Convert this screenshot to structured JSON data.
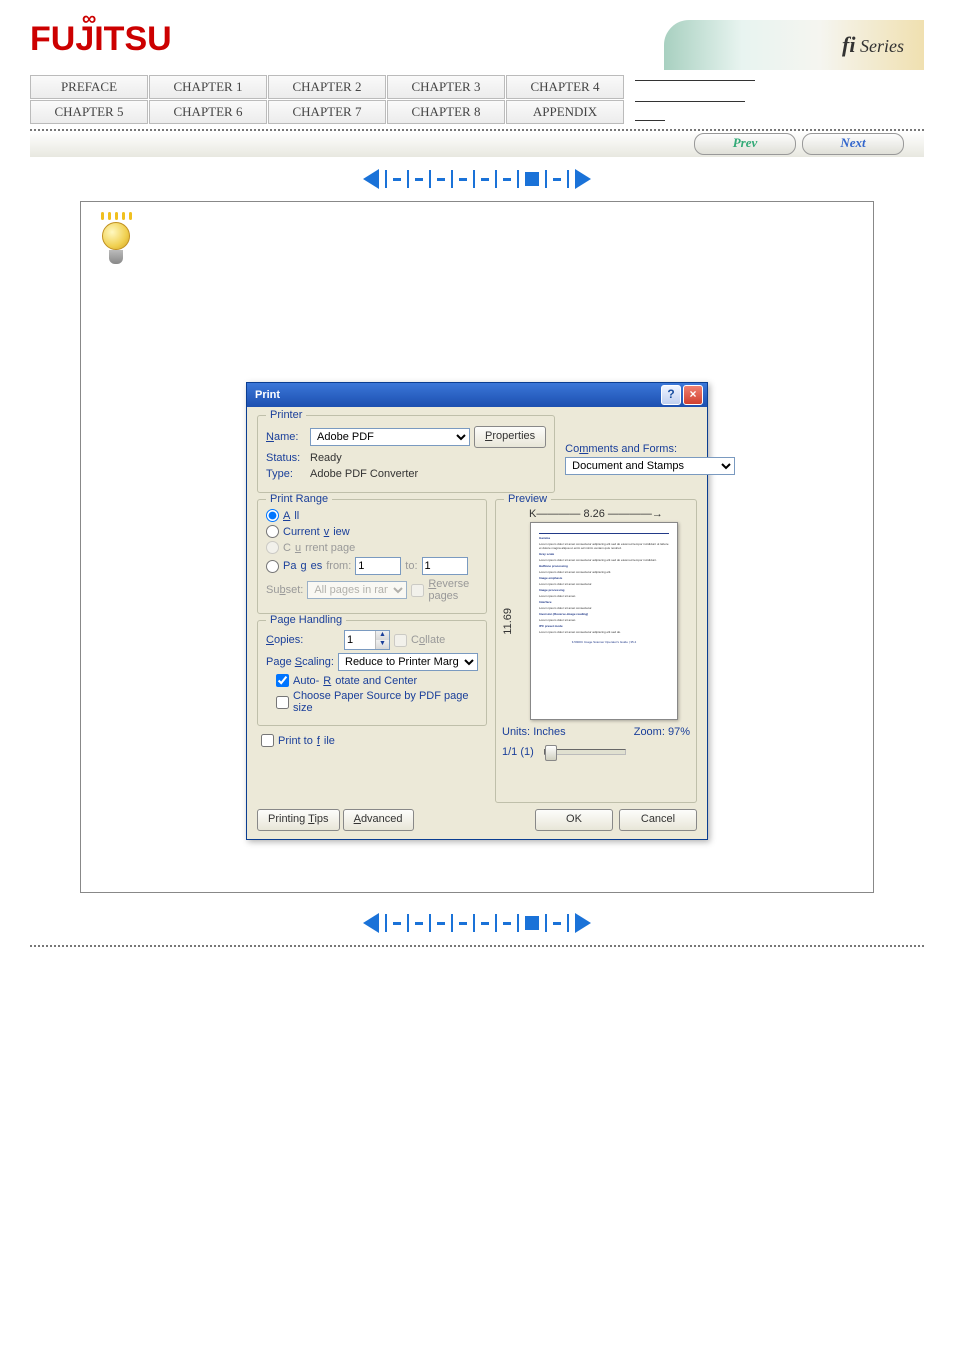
{
  "brand": {
    "logo_text": "FUJITSU",
    "series_label": "fi Series"
  },
  "tabs": {
    "row1": [
      "PREFACE",
      "CHAPTER 1",
      "CHAPTER 2",
      "CHAPTER 3",
      "CHAPTER 4"
    ],
    "row2": [
      "CHAPTER 5",
      "CHAPTER 6",
      "CHAPTER 7",
      "CHAPTER 8",
      "APPENDIX"
    ]
  },
  "nav": {
    "prev": "Prev",
    "next": "Next"
  },
  "dialog": {
    "title": "Print",
    "help_btn": "?",
    "close_btn": "×",
    "printer": {
      "legend": "Printer",
      "name_label": "Name:",
      "name_value": "Adobe PDF",
      "properties_btn": "Properties",
      "status_label": "Status:",
      "status_value": "Ready",
      "type_label": "Type:",
      "type_value": "Adobe PDF Converter",
      "comments_label": "Comments and Forms:",
      "comments_value": "Document and Stamps"
    },
    "range": {
      "legend": "Print Range",
      "all": "All",
      "current_view": "Current view",
      "current_page": "Current page",
      "pages": "Pages",
      "from": "from:",
      "from_value": "1",
      "to": "to:",
      "to_value": "1",
      "subset": "Subset:",
      "subset_value": "All pages in range",
      "reverse": "Reverse pages"
    },
    "handling": {
      "legend": "Page Handling",
      "copies": "Copies:",
      "copies_value": "1",
      "collate": "Collate",
      "scaling": "Page Scaling:",
      "scaling_value": "Reduce to Printer Margins",
      "autorotate": "Auto-Rotate and Center",
      "choose_source": "Choose Paper Source by PDF page size"
    },
    "print_to_file": "Print to file",
    "preview": {
      "legend": "Preview",
      "width": "8.26",
      "height": "11.69",
      "units_label": "Units:",
      "units_value": "Inches",
      "zoom_label": "Zoom:",
      "zoom_value": "97%",
      "page_indicator": "1/1 (1)"
    },
    "buttons": {
      "printing_tips": "Printing Tips",
      "advanced": "Advanced",
      "ok": "OK",
      "cancel": "Cancel"
    }
  }
}
